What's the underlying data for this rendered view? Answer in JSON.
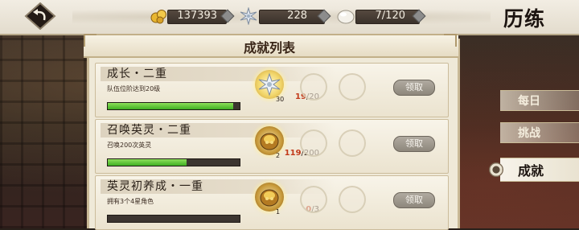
{
  "resources": {
    "coins": "137393",
    "crystals": "228",
    "stamina": "7/120"
  },
  "page_title": "历练",
  "panel_title": "成就列表",
  "entries": [
    {
      "name": "成长・二重",
      "desc": "队伍位阶达到20级",
      "progress_current": "19",
      "progress_max": "/20",
      "progress_fraction": 0.95,
      "reward_icon": "shuriken-crystal-icon",
      "reward_count": "30",
      "claim_label": "领取"
    },
    {
      "name": "召唤英灵・二重",
      "desc": "召唤200次英灵",
      "progress_current": "119",
      "progress_max": "/200",
      "progress_fraction": 0.595,
      "reward_icon": "gold-coin-pouch-icon",
      "reward_count": "2",
      "claim_label": "领取"
    },
    {
      "name": "英灵初养成・一重",
      "desc": "拥有3个4星角色",
      "progress_current": "0",
      "progress_max": "/3",
      "progress_fraction": 0,
      "reward_icon": "gold-coin-pouch-icon",
      "reward_count": "1",
      "claim_label": "领取"
    }
  ],
  "side_tabs": [
    {
      "label": "每日",
      "active": false
    },
    {
      "label": "挑战",
      "active": false
    },
    {
      "label": "成就",
      "active": true
    }
  ]
}
